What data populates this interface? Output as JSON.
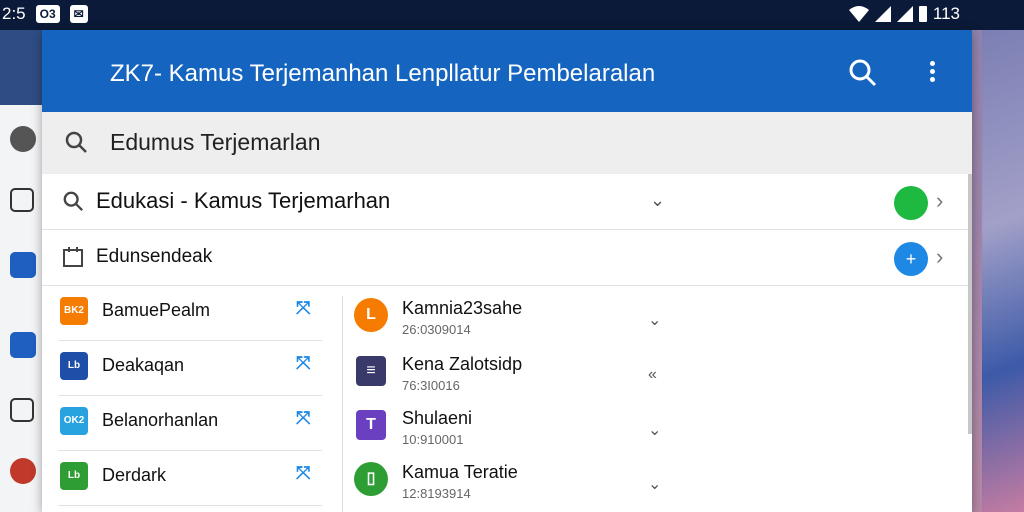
{
  "status": {
    "time": "2:5",
    "notif_chip": "O3",
    "battery": "113"
  },
  "app_bar": {
    "title": "ZK7- Kamus Terjemanhan Lenpllatur Pembelaralan",
    "search_icon": "search-icon",
    "menu_icon": "more-vert-icon"
  },
  "search": {
    "value": "Edumus Terjemarlan"
  },
  "rows": [
    {
      "label": "Edukasi - Kamus Terjemarhan",
      "dot_color": "#1db940"
    },
    {
      "label": "Edunsendeak",
      "dot_color": "#1e88e5"
    }
  ],
  "left_items": [
    {
      "badge": "BK2",
      "badge_color": "#f57c00",
      "label": "BamuePealm"
    },
    {
      "badge": "Lb",
      "badge_color": "#1e4fa8",
      "label": "Deakaqan"
    },
    {
      "badge": "OK2",
      "badge_color": "#29a3e0",
      "label": "Belanorhanlan"
    },
    {
      "badge": "Lb",
      "badge_color": "#2e9e34",
      "label": "Derdark"
    }
  ],
  "right_items": [
    {
      "icon_text": "L",
      "icon_color": "#f57c00",
      "name": "Kamnia23sahe",
      "sub": "26:0309014"
    },
    {
      "icon_text": "≡",
      "icon_color": "#3a3a6a",
      "name": "Kena Zalotsidp",
      "sub": "76:3I0016"
    },
    {
      "icon_text": "T",
      "icon_color": "#6a3fc0",
      "name": "Shulaeni",
      "sub": "10:910001"
    },
    {
      "icon_text": "▯",
      "icon_color": "#2e9e34",
      "name": "Kamua Teratie",
      "sub": "12:8193914"
    }
  ]
}
